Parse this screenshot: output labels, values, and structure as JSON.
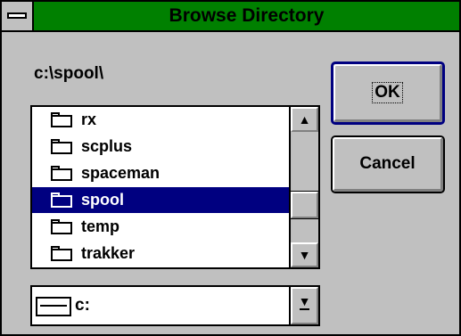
{
  "window": {
    "title": "Browse Directory"
  },
  "current_directory": "c:\\spool\\",
  "directory_list": {
    "items": [
      {
        "name": "rx",
        "selected": false
      },
      {
        "name": "scplus",
        "selected": false
      },
      {
        "name": "spaceman",
        "selected": false
      },
      {
        "name": "spool",
        "selected": true
      },
      {
        "name": "temp",
        "selected": false
      },
      {
        "name": "trakker",
        "selected": false
      }
    ]
  },
  "buttons": {
    "ok_label": "OK",
    "cancel_label": "Cancel"
  },
  "drive_combo": {
    "selected_drive": "c:"
  },
  "icons": {
    "system_menu": "system-menu-icon",
    "folder": "folder-icon",
    "scroll_up": "scroll-up-arrow-icon",
    "scroll_down": "scroll-down-arrow-icon",
    "drive": "drive-icon",
    "dropdown": "dropdown-arrow-icon"
  },
  "colors": {
    "title_bar": "#008000",
    "selection": "#000080",
    "face": "#c0c0c0"
  }
}
